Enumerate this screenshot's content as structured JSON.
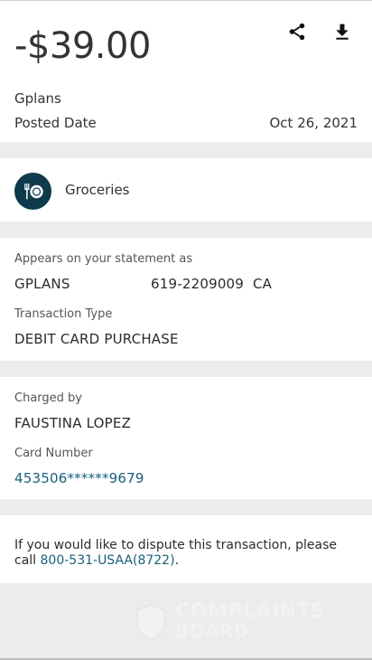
{
  "header": {
    "amount": "-$39.00",
    "merchant": "Gplans",
    "posted_label": "Posted Date",
    "posted_date": "Oct 26, 2021",
    "share_icon": "share-icon",
    "download_icon": "download-icon"
  },
  "category": {
    "icon": "restaurant-icon",
    "label": "Groceries",
    "icon_color": "#0f3a4c"
  },
  "statement": {
    "appears_label": "Appears on your statement as",
    "name": "GPLANS",
    "phone_state": "619-2209009  CA",
    "type_label": "Transaction Type",
    "type_value": "DEBIT CARD PURCHASE"
  },
  "charged": {
    "charged_label": "Charged by",
    "charged_value": "FAUSTINA LOPEZ",
    "card_label": "Card Number",
    "card_value": "453506******9679"
  },
  "dispute": {
    "text": "If you would like to dispute this transaction, please call ",
    "phone": "800-531-USAA(8722)",
    "end": "."
  },
  "watermark": {
    "line1": "COMPLAINTS",
    "line2": "BOARD"
  },
  "colors": {
    "link": "#17607c",
    "background": "#ececec"
  }
}
